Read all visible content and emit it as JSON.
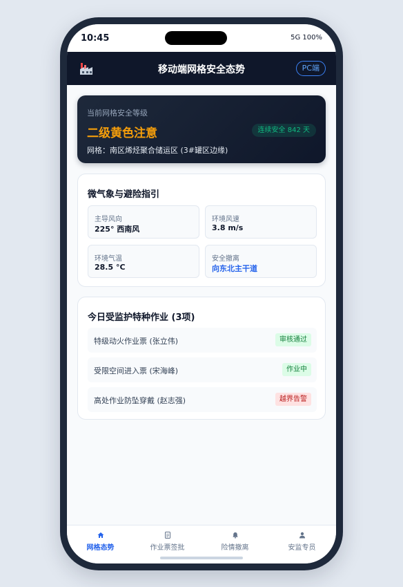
{
  "status_bar": {
    "time": "10:45",
    "network": "5G",
    "battery": "100%"
  },
  "header": {
    "icon": "factory-icon",
    "title": "移动端网格安全态势",
    "pc_button": "PC端"
  },
  "risk": {
    "label": "当前网格安全等级",
    "level": "二级黄色注意",
    "safe_days": "连续安全 842 天",
    "grid": "网格：南区烯烃聚合储运区 (3#罐区边缘)",
    "level_color": "#f59e0b"
  },
  "weather": {
    "title": "微气象与避险指引",
    "cells": [
      {
        "label": "主导风向",
        "value": "225° 西南风"
      },
      {
        "label": "环境风速",
        "value": "3.8 m/s"
      },
      {
        "label": "环境气温",
        "value": "28.5 °C"
      },
      {
        "label": "安全撤离",
        "value": "向东北主干道"
      }
    ]
  },
  "work": {
    "title": "今日受监护特种作业 (3项)",
    "tasks": [
      {
        "name": "特级动火作业票 (张立伟)",
        "status": "审核通过"
      },
      {
        "name": "受限空间进入票 (宋海峰)",
        "status": "作业中"
      },
      {
        "name": "高处作业防坠穿戴 (赵志强)",
        "status": "越界告警"
      }
    ]
  },
  "tabs": [
    {
      "label": "网格态势",
      "icon": "home-icon",
      "active": true
    },
    {
      "label": "作业票签批",
      "icon": "document-icon"
    },
    {
      "label": "险情撤离",
      "icon": "bell-icon"
    },
    {
      "label": "安监专员",
      "icon": "user-icon"
    }
  ],
  "colors": {
    "accent": "#2563eb",
    "dark": "#0f172a",
    "warning": "#f59e0b",
    "ok": "#10b981",
    "alarm": "#b91c1c"
  }
}
